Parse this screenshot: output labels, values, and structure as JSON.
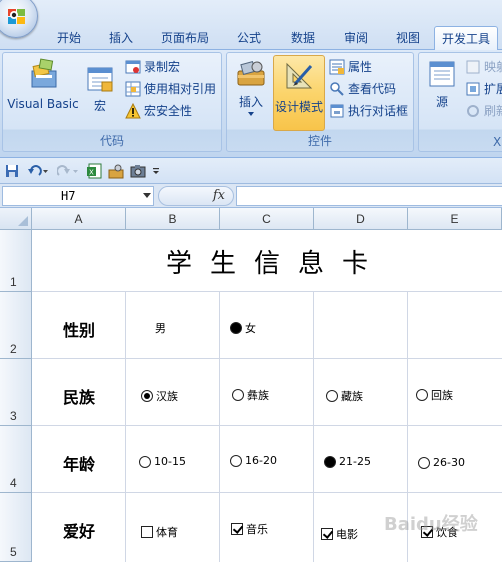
{
  "ribbon_tabs": [
    "开始",
    "插入",
    "页面布局",
    "公式",
    "数据",
    "审阅",
    "视图",
    "开发工具"
  ],
  "active_tab": "开发工具",
  "groups": {
    "code": {
      "label": "代码",
      "visual_basic": "Visual Basic",
      "macros": "宏",
      "record_macro": "录制宏",
      "relative_ref": "使用相对引用",
      "macro_security": "宏安全性"
    },
    "controls": {
      "label": "控件",
      "insert": "插入",
      "design_mode": "设计模式",
      "properties": "属性",
      "view_code": "查看代码",
      "run_dialog": "执行对话框"
    },
    "xml": {
      "label": "XI",
      "source": "源",
      "map_props": "映射",
      "expansion_packs": "扩展",
      "refresh": "刷新"
    }
  },
  "formula_bar": {
    "name_box": "H7",
    "fx": "fx",
    "formula": ""
  },
  "columns": [
    "A",
    "B",
    "C",
    "D",
    "E"
  ],
  "rows": [
    "1",
    "2",
    "3",
    "4",
    "5"
  ],
  "sheet": {
    "title": "学生信息卡",
    "labels": {
      "gender": "性别",
      "ethnicity": "民族",
      "age": "年龄",
      "hobby": "爱好"
    },
    "gender_options": [
      {
        "label": "男",
        "selected": false,
        "radio_visible": false
      },
      {
        "label": "女",
        "selected": true
      }
    ],
    "ethnicity_options": [
      {
        "label": "汉族",
        "selected": true
      },
      {
        "label": "彝族",
        "selected": false
      },
      {
        "label": "藏族",
        "selected": false
      },
      {
        "label": "回族",
        "selected": false
      }
    ],
    "age_options": [
      {
        "label": "10-15",
        "selected": false
      },
      {
        "label": "16-20",
        "selected": false
      },
      {
        "label": "21-25",
        "selected": true
      },
      {
        "label": "26-30",
        "selected": false
      }
    ],
    "hobby_options": [
      {
        "label": "体育",
        "checked": false
      },
      {
        "label": "音乐",
        "checked": true
      },
      {
        "label": "电影",
        "checked": true
      },
      {
        "label": "饮食",
        "checked": true
      }
    ]
  },
  "watermark": "Baidu经验"
}
